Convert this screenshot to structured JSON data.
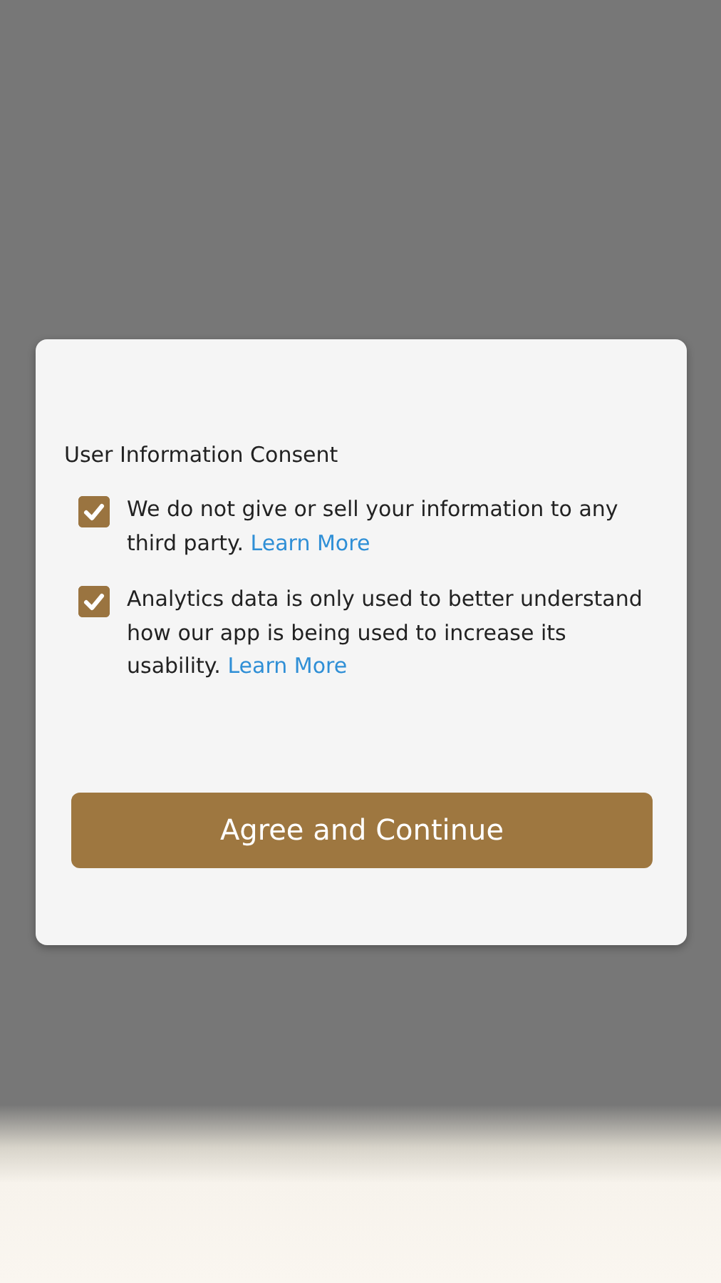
{
  "dialog": {
    "title": "User Information Consent",
    "items": [
      {
        "text": "We do not give or sell your information to any third party.",
        "link": "Learn More",
        "checked": true
      },
      {
        "text": "Analytics data is only used to better understand how our app is being used to increase its usability.",
        "link": "Learn More",
        "checked": true
      }
    ],
    "button": "Agree and Continue"
  }
}
